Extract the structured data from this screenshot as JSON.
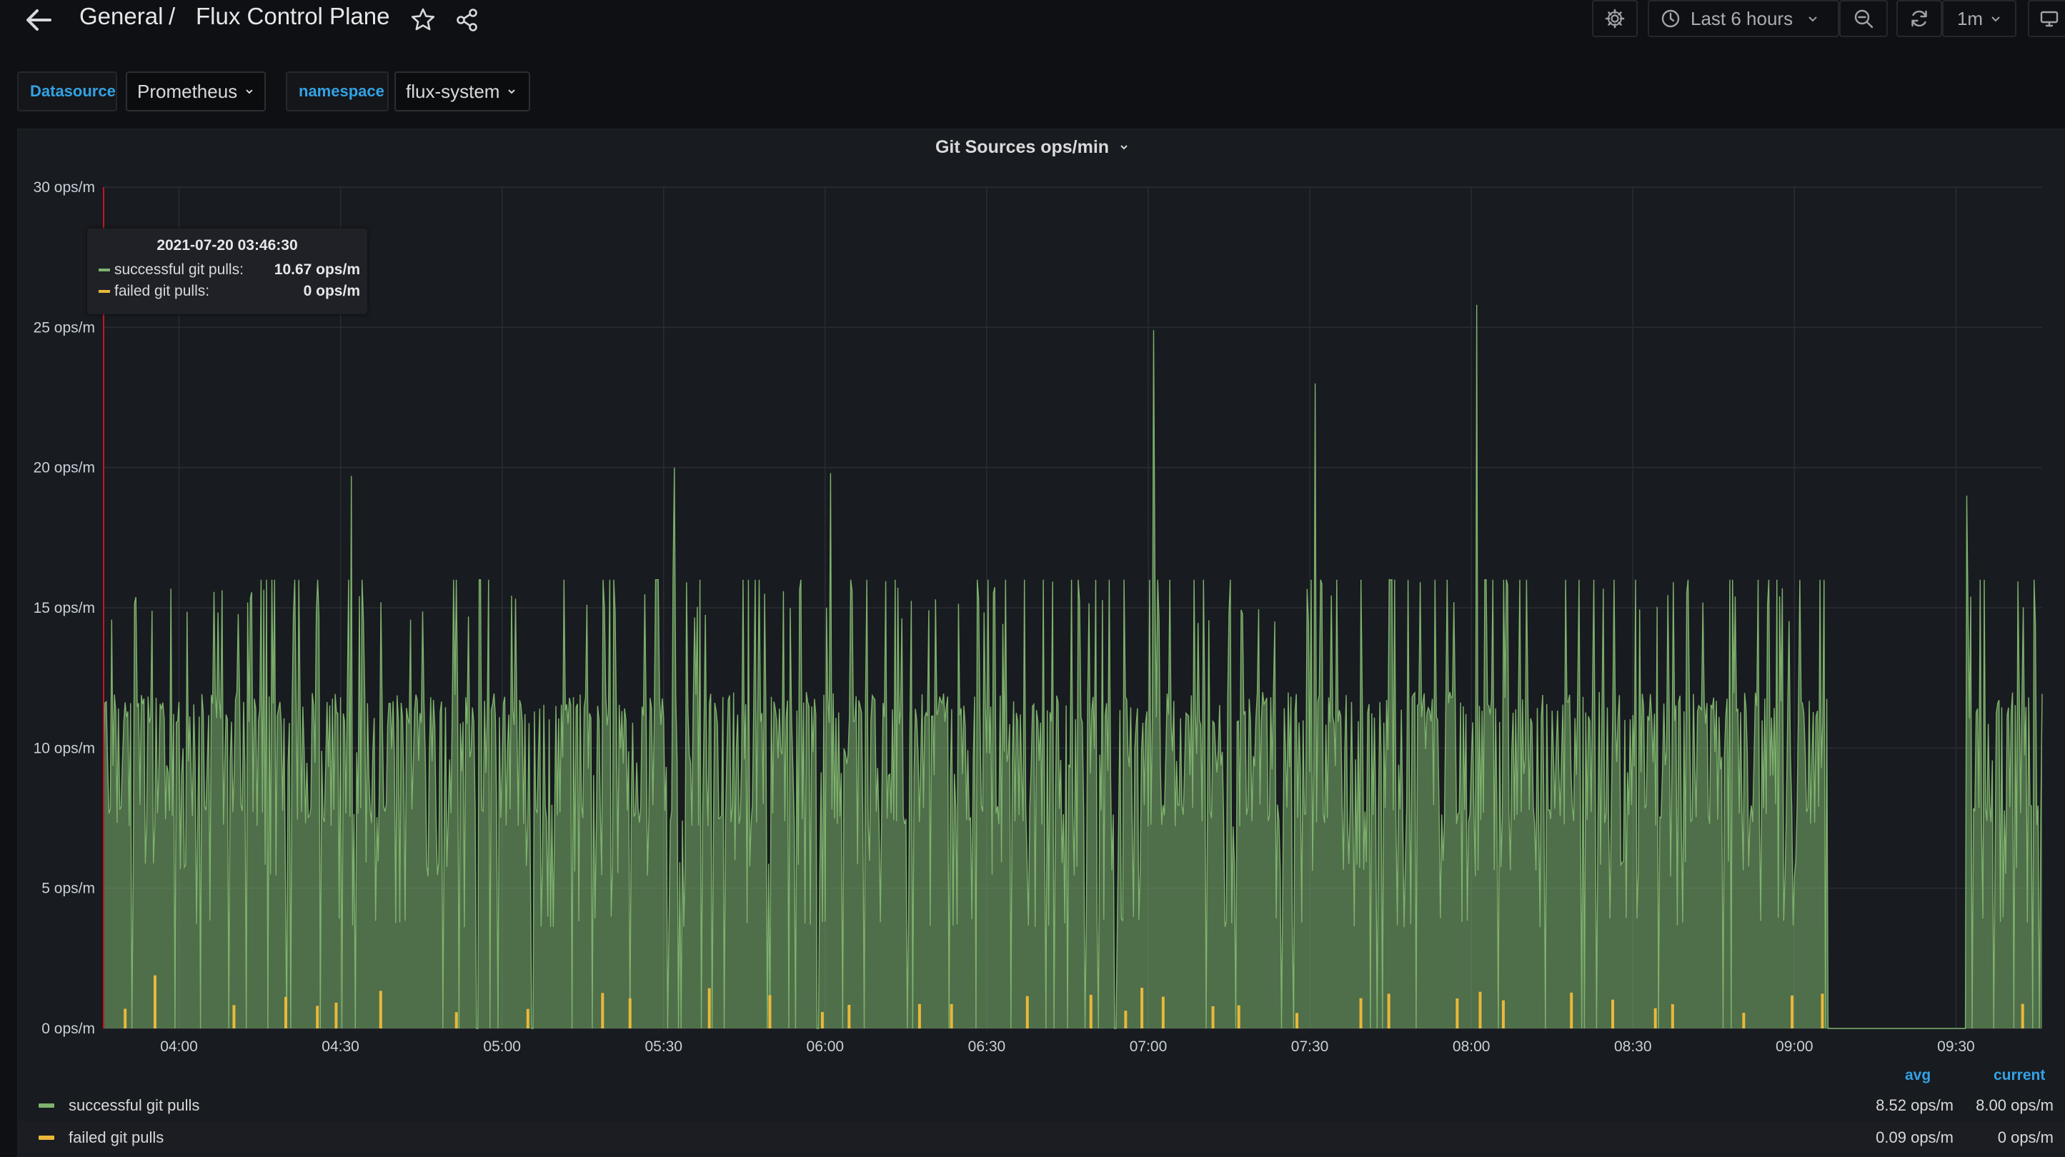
{
  "header": {
    "breadcrumb_folder": "General",
    "breadcrumb_separator": "/",
    "dashboard_title": "Flux Control Plane",
    "time_range": "Last 6 hours",
    "refresh_interval": "1m"
  },
  "variables": [
    {
      "label": "Datasource",
      "value": "Prometheus"
    },
    {
      "label": "namespace",
      "value": "flux-system"
    }
  ],
  "panel": {
    "title": "Git Sources ops/min"
  },
  "tooltip": {
    "time": "2021-07-20 03:46:30",
    "rows": [
      {
        "name": "successful git pulls:",
        "value": "10.67 ops/m"
      },
      {
        "name": "failed git pulls:",
        "value": "0 ops/m"
      }
    ]
  },
  "legend": {
    "headers": {
      "avg": "avg",
      "current": "current"
    },
    "rows": [
      {
        "name": "successful git pulls",
        "avg": "8.52 ops/m",
        "current": "8.00 ops/m",
        "color": "#7eb26d"
      },
      {
        "name": "failed git pulls",
        "avg": "0.09 ops/m",
        "current": "0 ops/m",
        "color": "#eab839"
      }
    ]
  },
  "chart_data": {
    "type": "area",
    "title": "Git Sources ops/min",
    "ylim": [
      0,
      30
    ],
    "y_ticks": [
      "0 ops/m",
      "5 ops/m",
      "10 ops/m",
      "15 ops/m",
      "20 ops/m",
      "25 ops/m",
      "30 ops/m"
    ],
    "x_ticks": [
      "04:00",
      "04:30",
      "05:00",
      "05:30",
      "06:00",
      "06:30",
      "07:00",
      "07:30",
      "08:00",
      "08:30",
      "09:00",
      "09:30"
    ],
    "x_range": [
      "03:46",
      "09:46"
    ],
    "grid": true,
    "series": [
      {
        "name": "successful git pulls",
        "color": "#7eb26d",
        "baseline_band": [
          8,
          12
        ],
        "peaks": [
          {
            "time": "04:32",
            "value": 19.7
          },
          {
            "time": "05:32",
            "value": 20.0
          },
          {
            "time": "06:01",
            "value": 19.8
          },
          {
            "time": "07:01",
            "value": 24.9
          },
          {
            "time": "07:31",
            "value": 23.0
          },
          {
            "time": "08:01",
            "value": 25.8
          },
          {
            "time": "09:32",
            "value": 19.0
          }
        ],
        "gap": [
          "09:06",
          "09:32"
        ]
      },
      {
        "name": "failed git pulls",
        "color": "#eab839",
        "typical": [
          0.5,
          1.5
        ],
        "max": 2.6
      }
    ]
  },
  "colors": {
    "accent": "#33a2e5",
    "success": "#7eb26d",
    "warning": "#eab839",
    "background": "#0f1014",
    "panel": "#181b1f"
  }
}
